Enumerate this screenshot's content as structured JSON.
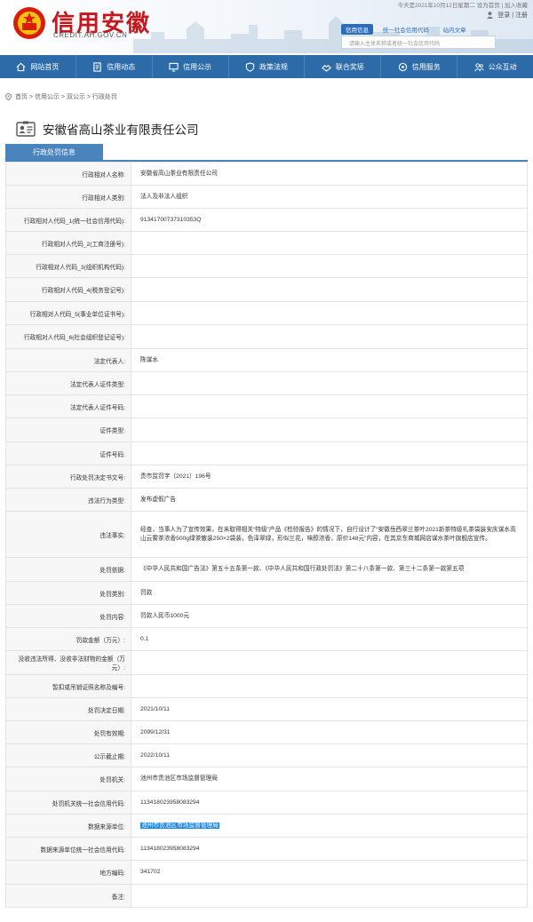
{
  "header": {
    "logo_text": "信用安徽",
    "logo_url": "CREDIT.AH.GOV.CN",
    "top_info": "今天是2021年10月12日星期二    设为首页 | 加入收藏",
    "login": "登录",
    "register": "注册",
    "search_tabs": [
      "信用信息",
      "统一社会信用代码",
      "站内文章"
    ],
    "search_placeholder": "请输入主体名称或者统一社会信用代码"
  },
  "nav": [
    {
      "label": "网站首页",
      "icon": "home-icon"
    },
    {
      "label": "信用动态",
      "icon": "document-icon"
    },
    {
      "label": "信用公示",
      "icon": "monitor-icon"
    },
    {
      "label": "政策法规",
      "icon": "shield-icon"
    },
    {
      "label": "联合奖惩",
      "icon": "hands-icon"
    },
    {
      "label": "信用服务",
      "icon": "service-icon"
    },
    {
      "label": "公众互动",
      "icon": "people-icon"
    }
  ],
  "breadcrumb": "首页 > 信用公示 > 双公示 > 行政处罚",
  "company_name": "安徽省高山茶业有限责任公司",
  "tab_label": "行政处罚信息",
  "rows": [
    {
      "label": "行政相对人名称:",
      "value": "安徽省高山茶业有限责任公司"
    },
    {
      "label": "行政相对人类别:",
      "value": "法人及非法人组织"
    },
    {
      "label": "行政相对人代码_1(统一社会信用代码):",
      "value": "91341700737310353Q"
    },
    {
      "label": "行政相对人代码_2(工商注册号):",
      "value": ""
    },
    {
      "label": "行政相对人代码_3(组织机构代码):",
      "value": ""
    },
    {
      "label": "行政相对人代码_4(税务登记号):",
      "value": ""
    },
    {
      "label": "行政相对人代码_5(事业单位证书号):",
      "value": ""
    },
    {
      "label": "行政相对人代码_6(社会组织登记证号):",
      "value": ""
    },
    {
      "label": "法定代表人:",
      "value": "陈谋水"
    },
    {
      "label": "法定代表人证件类型:",
      "value": ""
    },
    {
      "label": "法定代表人证件号码:",
      "value": ""
    },
    {
      "label": "证件类型:",
      "value": ""
    },
    {
      "label": "证件号码:",
      "value": ""
    },
    {
      "label": "行政处罚决定书文号:",
      "value": "贵市监罚字〔2021〕196号"
    },
    {
      "label": "违法行为类型:",
      "value": "发布虚假广告"
    },
    {
      "label": "违法事实:",
      "value": "经查，当事人为了宣传效果，在未取得相关“特级”产品《检验报告》的情况下，自行设计了“安徽岳西翠兰茶叶2021新茶特级礼茶袋装安庆谋水高山云雾茶浓香500g绿茶散装250×2袋装，色泽翠绿，形似兰花，味醇浓香，原价148元”内容，在其京东商城网店谋水茶叶旗舰店宣传。"
    },
    {
      "label": "处罚依据:",
      "value": "《中华人民共和国广告法》第五十五条第一款、《中华人民共和国行政处罚法》第二十八条第一款、第三十二条第一款第五项"
    },
    {
      "label": "处罚类别:",
      "value": "罚款"
    },
    {
      "label": "处罚内容:",
      "value": "罚款人民币1000元"
    },
    {
      "label": "罚款金额（万元）:",
      "value": "0.1"
    },
    {
      "label": "没收违法所得、没收非法财物的金额（万元）:",
      "value": ""
    },
    {
      "label": "暂扣或吊销证照名称及编号:",
      "value": ""
    },
    {
      "label": "处罚决定日期:",
      "value": "2021/10/11"
    },
    {
      "label": "处罚有效期:",
      "value": "2099/12/31"
    },
    {
      "label": "公示截止期:",
      "value": "2022/10/11"
    },
    {
      "label": "处罚机关:",
      "value": "池州市贵池区市场监督管理局"
    },
    {
      "label": "处罚机关统一社会信用代码:",
      "value": "11341802395808329​4"
    },
    {
      "label": "数据来源单位:",
      "value": "池州市贵池区市场监督管理局",
      "highlight": true
    },
    {
      "label": "数据来源单位统一社会信用代码:",
      "value": "113418023958083294"
    },
    {
      "label": "地方编码:",
      "value": "341702"
    },
    {
      "label": "备注:",
      "value": ""
    }
  ]
}
